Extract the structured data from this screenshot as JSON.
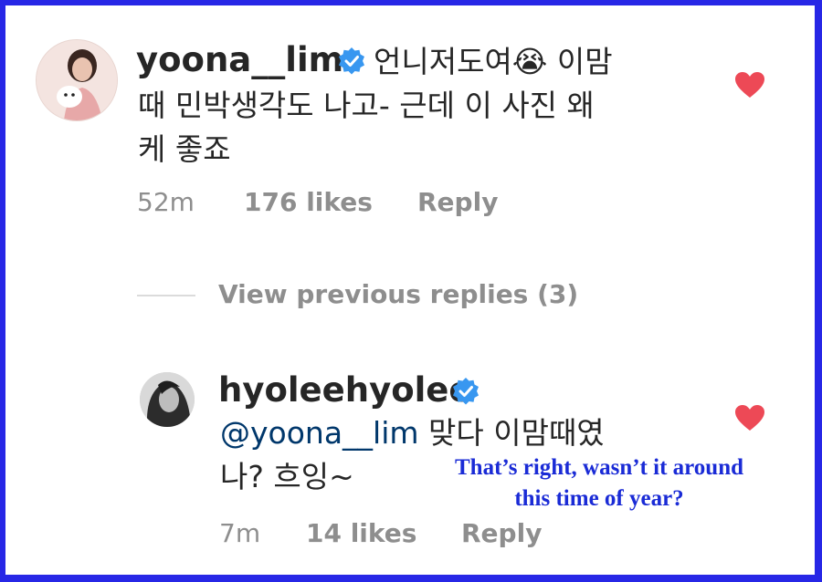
{
  "comment1": {
    "username": "yoona__lim",
    "line1": "언니저도여😭  이맘",
    "line2": "때 민박생각도 나고-  근데 이 사진 왜",
    "line3": "케 좋죠",
    "time": "52m",
    "likes": "176 likes",
    "reply": "Reply"
  },
  "view_previous": "View previous replies (3)",
  "comment2": {
    "username": "hyoleehyolee",
    "mention": "@yoona__lim",
    "line1_rest": " 맞다 이맘때였",
    "line2": "나? 흐잉~",
    "time": "7m",
    "likes": "14 likes",
    "reply": "Reply"
  },
  "translation": {
    "line1": "That’s right, wasn’t it around",
    "line2": "this time of year?"
  },
  "colors": {
    "border": "#2727e6",
    "heart": "#ed4956",
    "verified": "#3897f0",
    "translation": "#1a2bd6"
  },
  "icons": [
    "verified-badge-icon",
    "heart-icon"
  ]
}
